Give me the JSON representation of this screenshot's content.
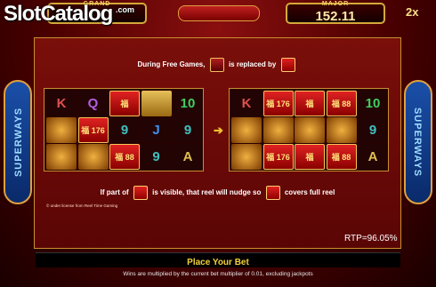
{
  "header": {
    "logo_text": "SlotCatalog",
    "logo_suffix": ".com",
    "grand": {
      "label": "GRAND",
      "value": ""
    },
    "major": {
      "label": "MAJOR",
      "value": "152.11"
    },
    "multiplier_badge": "2x"
  },
  "side_banner": {
    "text": "SUPERWAYS"
  },
  "panel": {
    "line1_prefix": "During Free Games,",
    "line1_middle": "is replaced by",
    "line2_prefix": "If part of",
    "line2_middle": "is visible, that reel will nudge so",
    "line2_suffix": "covers full reel",
    "license": "© under license from Reel Time Gaming",
    "left_grid": [
      [
        "K",
        "Q",
        "福",
        "gold",
        "10"
      ],
      [
        "temple",
        "福 176",
        "9",
        "J",
        "9"
      ],
      [
        "temple",
        "dragon",
        "福 88",
        "9",
        "A"
      ]
    ],
    "right_grid": [
      [
        "K",
        "福 176",
        "福",
        "福 88",
        "10"
      ],
      [
        "temple",
        "dragon",
        "dragon",
        "dragon",
        "9"
      ],
      [
        "temple",
        "福 176",
        "福",
        "福 88",
        "A"
      ]
    ]
  },
  "rtp": "RTP=96.05%",
  "bet_button": {
    "label": "Place Your Bet"
  },
  "footer_text": "Wins are multiplied by the current bet multiplier of 0.01, excluding jackpots",
  "colors": {
    "panel_bg": "#7a0f0a",
    "gold": "#c89030",
    "bet_text": "#f2d13a",
    "side_blue": "#1a4fa8"
  }
}
